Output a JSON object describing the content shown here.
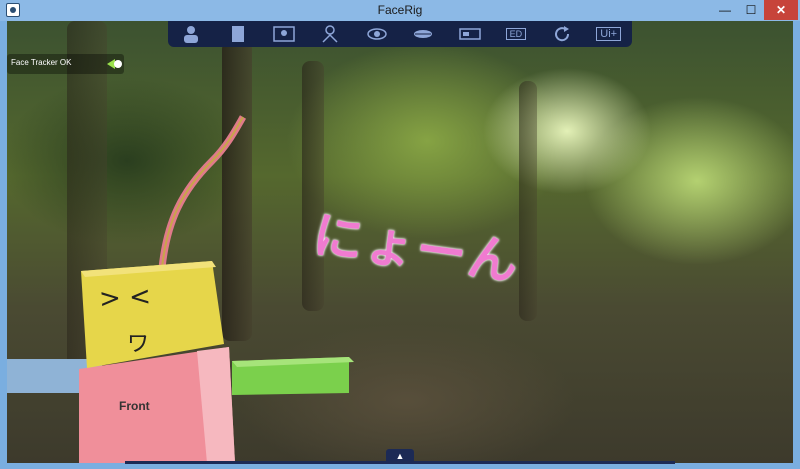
{
  "window": {
    "title": "FaceRig",
    "controls": {
      "minimize": "—",
      "maximize": "☐",
      "close": "✕"
    }
  },
  "toolbar": {
    "buttons": [
      {
        "name": "avatar-icon"
      },
      {
        "name": "film-icon"
      },
      {
        "name": "background-icon"
      },
      {
        "name": "tracking-icon"
      },
      {
        "name": "eye-icon"
      },
      {
        "name": "lips-icon"
      },
      {
        "name": "settings-panel-icon"
      },
      {
        "name": "record-icon",
        "label": "ED"
      },
      {
        "name": "refresh-icon"
      },
      {
        "name": "ui-plus-icon",
        "label": "Ui+"
      }
    ]
  },
  "status": {
    "text": "Face Tracker OK"
  },
  "scene": {
    "caption": "にょーん",
    "shirt_label": "Front",
    "face_text": "> <",
    "mouth_text": "ワ",
    "colors": {
      "head": "#e6d64a",
      "body": "#f08f9a",
      "arm_right": "#7bd04c",
      "arm_left": "#8fb3d6",
      "antenna": "#e07a8a",
      "caption": "#f07bd0"
    }
  },
  "bottom": {
    "expand_icon": "▲"
  }
}
